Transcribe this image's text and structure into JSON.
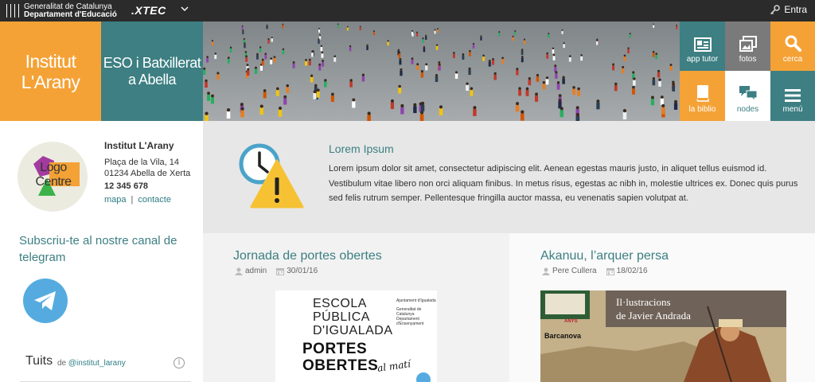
{
  "topbar": {
    "gencat_line1": "Generalitat de Catalunya",
    "gencat_line2": "Departament d'Educació",
    "xtec": ".XTEC",
    "login": "Entra"
  },
  "header": {
    "school": "Institut L'Arany",
    "levels": "ESO i Batxillerat a Abella",
    "tiles": [
      {
        "label": "app tutor",
        "icon": "id-card-icon",
        "color": "#3d7f82"
      },
      {
        "label": "fotos",
        "icon": "photos-icon",
        "color": "#7a7a7a"
      },
      {
        "label": "cerca",
        "icon": "search-icon",
        "color": "#f4a236"
      },
      {
        "label": "la biblio",
        "icon": "book-icon",
        "color": "#f4a236"
      },
      {
        "label": "nodes",
        "icon": "chat-icon",
        "color": "#ffffff"
      },
      {
        "label": "menú",
        "icon": "hamburger-icon",
        "color": "#3d7f82"
      }
    ]
  },
  "sidebar": {
    "logo_text": "Logo Centre",
    "school_name": "Institut L'Arany",
    "address_line1": "Plaça de la Vila, 14",
    "address_line2": "01234 Abella de Xerta",
    "phone": "12 345 678",
    "link_map": "mapa",
    "link_separator": "|",
    "link_contact": "contacte",
    "telegram_title": "Subscriu-te al nostre canal de telegram",
    "tweets_title": "Tuits",
    "tweets_by": "de",
    "tweets_handle": "@institut_larany",
    "info_glyph": "i"
  },
  "notice": {
    "title": "Lorem Ipsum",
    "body": "Lorem ipsum dolor sit amet, consectetur adipiscing elit. Aenean egestas mauris justo, in aliquet tellus euismod id. Vestibulum vitae libero non orci aliquam finibus. In metus risus, egestas ac nibh in, molestie ultrices ex. Donec quis purus sed felis rutrum semper. Pellentesque fringilla auctor massa, eu venenatis sapien volutpat at."
  },
  "posts": [
    {
      "title": "Jornada de portes obertes",
      "author": "admin",
      "date": "30/01/16",
      "poster": {
        "line1": "ESCOLA",
        "line2": "PÚBLICA",
        "line3": "D'IGUALADA",
        "bold1": "PORTES",
        "bold2": "OBERTES",
        "small1": "Ajuntament d'Igualada",
        "small2": "Generalitat de Catalunya",
        "small3": "Departament d'Ensenyament",
        "script": "al matí"
      }
    },
    {
      "title": "Akanuu, l’arquer persa",
      "author": "Pere Cullera",
      "date": "18/02/16",
      "poster": {
        "line1": "Il·lustracions",
        "line2": "de Javier Andrada",
        "publisher": "Barcanova",
        "anys": "ANYS"
      }
    }
  ]
}
